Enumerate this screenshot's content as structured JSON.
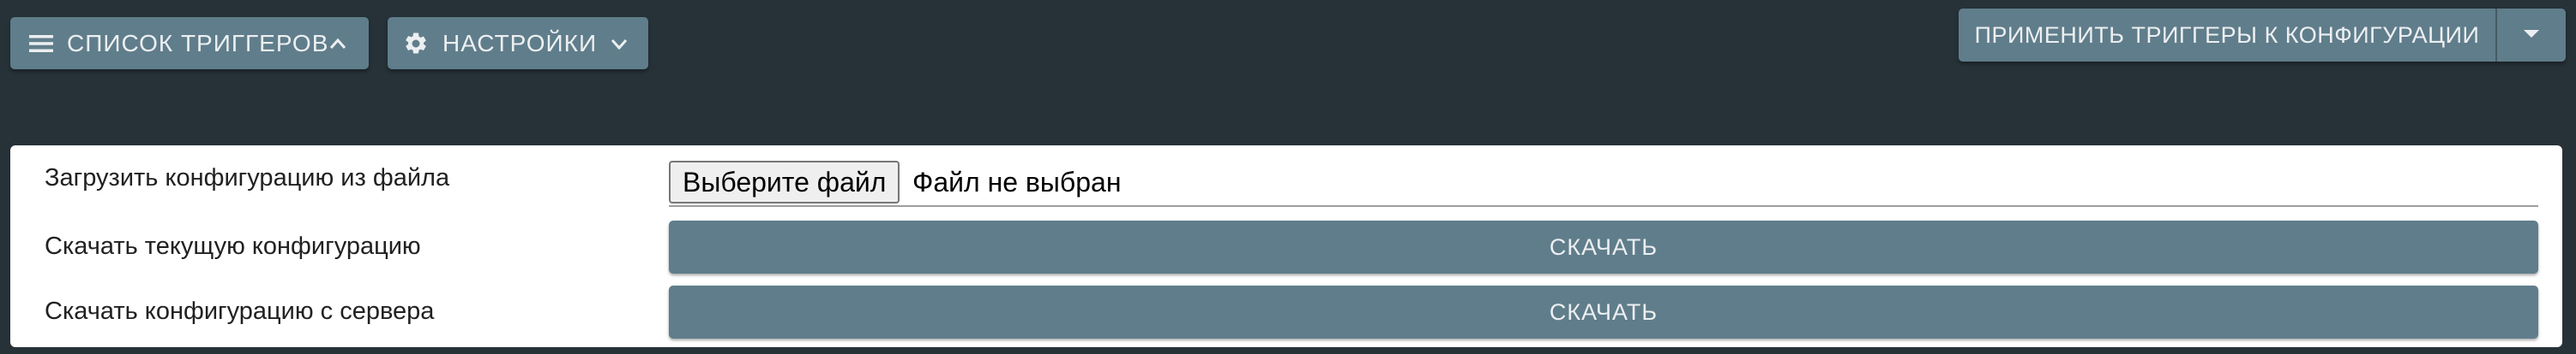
{
  "toolbar": {
    "triggers_list_label": "СПИСОК ТРИГГЕРОВ",
    "settings_label": "НАСТРОЙКИ",
    "apply_label": "ПРИМЕНИТЬ ТРИГГЕРЫ К КОНФИГУРАЦИИ"
  },
  "icons": {
    "triggers_menu": "menu-icon",
    "triggers_chevron": "chevron-up-icon",
    "settings_gear": "gear-icon",
    "settings_chevron": "chevron-down-icon",
    "apply_dropdown": "caret-down-icon"
  },
  "config": {
    "upload_label": "Загрузить конфигурацию из файла",
    "file_choose_label": "Выберите файл",
    "file_status": "Файл не выбран",
    "download_current_label": "Скачать текущую конфигурацию",
    "download_current_button": "СКАЧАТЬ",
    "download_server_label": "Скачать конфигурацию с сервера",
    "download_server_button": "СКАЧАТЬ"
  },
  "colors": {
    "background": "#263238",
    "button": "#607d8b",
    "button_text": "#eceff1",
    "card": "#ffffff"
  }
}
